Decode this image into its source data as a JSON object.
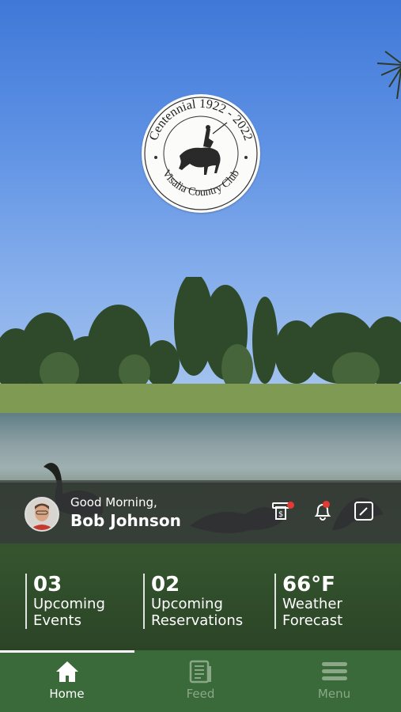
{
  "logo": {
    "top_text": "Centennial 1922 - 2022",
    "bottom_text": "Visalia Country Club"
  },
  "greeting": {
    "salutation": "Good Morning,",
    "name": "Bob Johnson"
  },
  "header_actions": [
    {
      "icon": "statement-icon",
      "has_alert": true
    },
    {
      "icon": "bell-icon",
      "has_alert": true
    },
    {
      "icon": "edit-icon",
      "has_alert": false
    }
  ],
  "stats": {
    "events": {
      "value": "03",
      "label_line1": "Upcoming",
      "label_line2": "Events"
    },
    "reservations": {
      "value": "02",
      "label_line1": "Upcoming",
      "label_line2": "Reservations"
    },
    "weather": {
      "value": "66°F",
      "label_line1": "Weather",
      "label_line2": "Forecast"
    }
  },
  "tabs": [
    {
      "label": "Home",
      "icon": "home-icon",
      "active": true
    },
    {
      "label": "Feed",
      "icon": "feed-icon",
      "active": false
    },
    {
      "label": "Menu",
      "icon": "menu-icon",
      "active": false
    }
  ],
  "colors": {
    "tab_bar": "#3b6a3a",
    "alert_dot": "#e53935",
    "inactive_tab": "#8aa887"
  }
}
